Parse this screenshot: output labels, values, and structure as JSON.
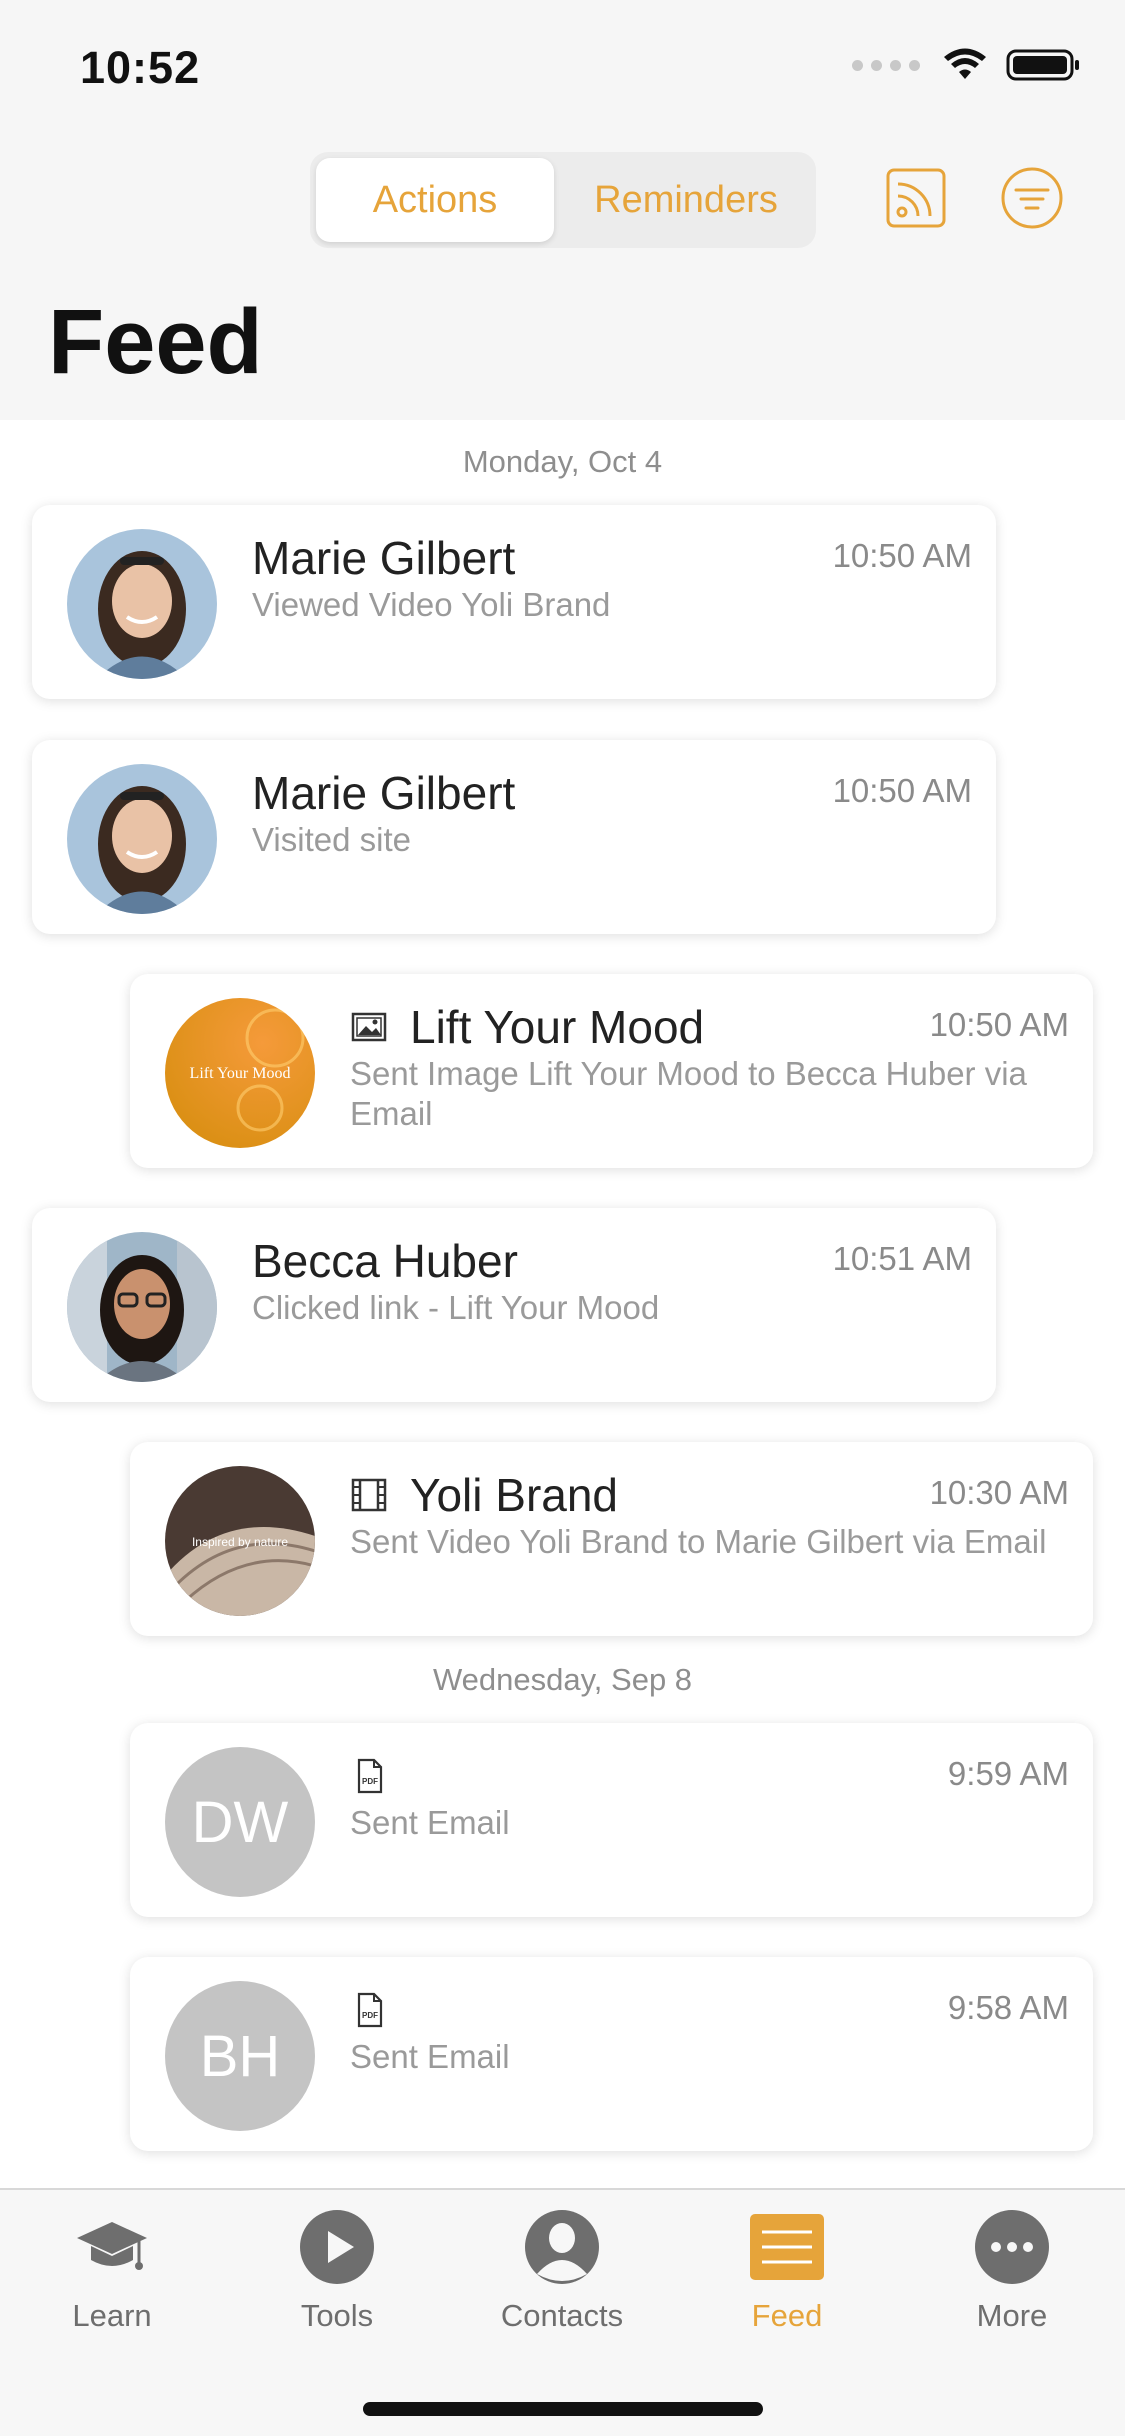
{
  "status": {
    "time": "10:52"
  },
  "header": {
    "segments": [
      "Actions",
      "Reminders"
    ],
    "active_segment": "Actions",
    "title": "Feed",
    "accent": "#E6A43A"
  },
  "feed": {
    "groups": [
      {
        "date": "Monday, Oct  4",
        "items": [
          {
            "avatar": "photo-marie-gilbert",
            "title": "Marie Gilbert",
            "time": "10:50 AM",
            "subtitle": "Viewed Video Yoli Brand"
          },
          {
            "avatar": "photo-marie-gilbert",
            "title": "Marie Gilbert",
            "time": "10:50 AM",
            "subtitle": "Visited site"
          },
          {
            "avatar": "image-lift-your-mood",
            "avatar_text": "Lift Your Mood",
            "type_icon": "image-icon",
            "title": "Lift Your Mood",
            "time": "10:50 AM",
            "subtitle": "Sent Image Lift Your Mood to Becca Huber via Email"
          },
          {
            "avatar": "photo-becca-huber",
            "title": "Becca Huber",
            "time": "10:51 AM",
            "subtitle": "Clicked link - Lift Your Mood"
          },
          {
            "avatar": "image-yoli-brand",
            "avatar_text": "Inspired by nature",
            "type_icon": "film-icon",
            "title": "Yoli Brand",
            "time": "10:30 AM",
            "subtitle": "Sent Video Yoli Brand to Marie Gilbert via Email"
          }
        ]
      },
      {
        "date": "Wednesday, Sep  8",
        "items": [
          {
            "initials": "DW",
            "type_icon": "pdf-icon",
            "pdf_text": "PDF",
            "time": "9:59 AM",
            "subtitle": "Sent Email"
          },
          {
            "initials": "BH",
            "type_icon": "pdf-icon",
            "pdf_text": "PDF",
            "time": "9:58 AM",
            "subtitle": "Sent Email"
          }
        ]
      }
    ]
  },
  "tabbar": {
    "tabs": [
      {
        "label": "Learn",
        "icon": "graduation-cap-icon"
      },
      {
        "label": "Tools",
        "icon": "play-icon"
      },
      {
        "label": "Contacts",
        "icon": "person-icon"
      },
      {
        "label": "Feed",
        "icon": "feed-list-icon",
        "active": true
      },
      {
        "label": "More",
        "icon": "more-dots-icon"
      }
    ]
  }
}
